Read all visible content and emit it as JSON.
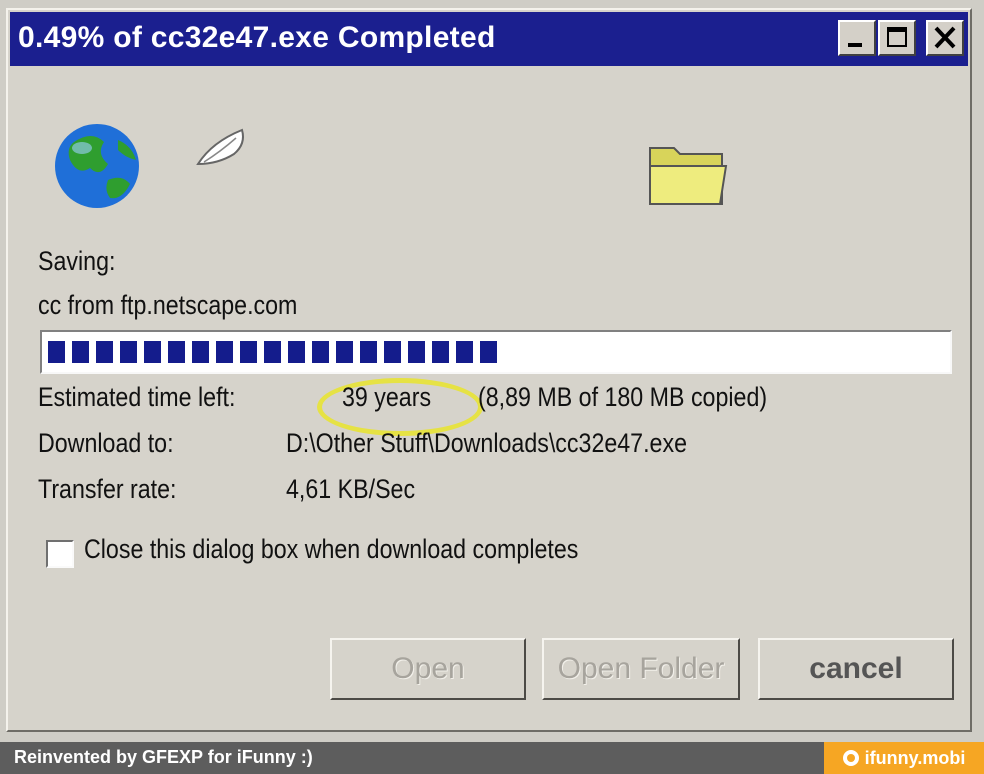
{
  "window": {
    "title": "0.49% of cc32e47.exe Completed",
    "percent_complete": 0.49,
    "title_buttons": {
      "minimize_icon": "minimize-icon",
      "maximize_icon": "maximize-icon",
      "close_icon": "close-icon"
    }
  },
  "dialog": {
    "saving_label": "Saving:",
    "source_text": "cc from ftp.netscape.com",
    "progress": {
      "filled_blocks": 19,
      "total_blocks": 51,
      "fill_color": "#141c8c"
    },
    "rows": {
      "time_label": "Estimated time left:",
      "time_value": "39 years",
      "copied_value": "(8,89 MB of 180 MB copied)",
      "download_label": "Download to:",
      "download_value": "D:\\Other Stuff\\Downloads\\cc32e47.exe",
      "rate_label": "Transfer rate:",
      "rate_value": "4,61 KB/Sec"
    },
    "checkbox": {
      "label": "Close this dialog box when download completes",
      "checked": false
    },
    "buttons": {
      "open": "Open",
      "open_folder": "Open Folder",
      "cancel": "cancel"
    },
    "icons": [
      "globe-icon",
      "paper-flying-icon",
      "folder-icon"
    ]
  },
  "footer": {
    "credit": "Reinvented by GFEXP for iFunny :)",
    "brand": "ifunny.mobi",
    "brand_color": "#f6a623"
  },
  "colors": {
    "titlebar": "#1b1f8f",
    "highlight": "#e6e244"
  }
}
